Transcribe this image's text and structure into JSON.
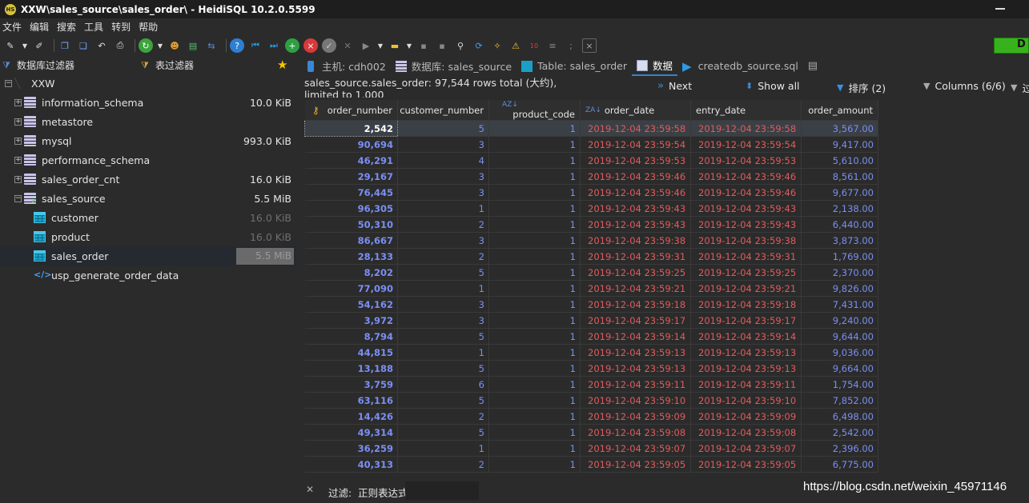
{
  "window": {
    "title": "XXW\\sales_source\\sales_order\\ - HeidiSQL 10.2.0.5599",
    "logo_text": "HS"
  },
  "menu": [
    "文件",
    "编辑",
    "搜索",
    "工具",
    "转到",
    "帮助"
  ],
  "toolbar": {
    "indicator_text": "D"
  },
  "left": {
    "db_filter_label": "数据库过滤器",
    "table_filter_label": "表过滤器",
    "tree": [
      {
        "label": "XXW",
        "size": "",
        "kind": "server"
      },
      {
        "label": "information_schema",
        "size": "10.0 KiB",
        "kind": "db"
      },
      {
        "label": "metastore",
        "size": "",
        "kind": "db"
      },
      {
        "label": "mysql",
        "size": "993.0 KiB",
        "kind": "db"
      },
      {
        "label": "performance_schema",
        "size": "",
        "kind": "db"
      },
      {
        "label": "sales_order_cnt",
        "size": "16.0 KiB",
        "kind": "db"
      },
      {
        "label": "sales_source",
        "size": "5.5 MiB",
        "kind": "db-open"
      },
      {
        "label": "customer",
        "size": "16.0 KiB",
        "kind": "table"
      },
      {
        "label": "product",
        "size": "16.0 KiB",
        "kind": "table"
      },
      {
        "label": "sales_order",
        "size": "5.5 MiB",
        "kind": "table-selected"
      },
      {
        "label": "usp_generate_order_data",
        "size": "",
        "kind": "procedure"
      }
    ]
  },
  "tabs": [
    {
      "label": "主机: cdh002"
    },
    {
      "label": "数据库: sales_source"
    },
    {
      "label": "Table: sales_order"
    },
    {
      "label": "数据"
    },
    {
      "label": "createdb_source.sql"
    }
  ],
  "info": {
    "row_info": "sales_source.sales_order: 97,544 rows total (大约), limited to 1,000",
    "next": "Next",
    "show_all": "Show all",
    "sort": "排序 (2)",
    "columns": "Columns (6/6)",
    "filter_trunc": "过"
  },
  "grid": {
    "columns": [
      "order_number",
      "customer_number",
      "product_code",
      "order_date",
      "entry_date",
      "order_amount"
    ],
    "rows": [
      [
        "2,542",
        "5",
        "1",
        "2019-12-04 23:59:58",
        "2019-12-04 23:59:58",
        "3,567.00"
      ],
      [
        "90,694",
        "3",
        "1",
        "2019-12-04 23:59:54",
        "2019-12-04 23:59:54",
        "9,417.00"
      ],
      [
        "46,291",
        "4",
        "1",
        "2019-12-04 23:59:53",
        "2019-12-04 23:59:53",
        "5,610.00"
      ],
      [
        "29,167",
        "3",
        "1",
        "2019-12-04 23:59:46",
        "2019-12-04 23:59:46",
        "8,561.00"
      ],
      [
        "76,445",
        "3",
        "1",
        "2019-12-04 23:59:46",
        "2019-12-04 23:59:46",
        "9,677.00"
      ],
      [
        "96,305",
        "1",
        "1",
        "2019-12-04 23:59:43",
        "2019-12-04 23:59:43",
        "2,138.00"
      ],
      [
        "50,310",
        "2",
        "1",
        "2019-12-04 23:59:43",
        "2019-12-04 23:59:43",
        "6,440.00"
      ],
      [
        "86,667",
        "3",
        "1",
        "2019-12-04 23:59:38",
        "2019-12-04 23:59:38",
        "3,873.00"
      ],
      [
        "28,133",
        "2",
        "1",
        "2019-12-04 23:59:31",
        "2019-12-04 23:59:31",
        "1,769.00"
      ],
      [
        "8,202",
        "5",
        "1",
        "2019-12-04 23:59:25",
        "2019-12-04 23:59:25",
        "2,370.00"
      ],
      [
        "77,090",
        "1",
        "1",
        "2019-12-04 23:59:21",
        "2019-12-04 23:59:21",
        "9,826.00"
      ],
      [
        "54,162",
        "3",
        "1",
        "2019-12-04 23:59:18",
        "2019-12-04 23:59:18",
        "7,431.00"
      ],
      [
        "3,972",
        "3",
        "1",
        "2019-12-04 23:59:17",
        "2019-12-04 23:59:17",
        "9,240.00"
      ],
      [
        "8,794",
        "5",
        "1",
        "2019-12-04 23:59:14",
        "2019-12-04 23:59:14",
        "9,644.00"
      ],
      [
        "44,815",
        "1",
        "1",
        "2019-12-04 23:59:13",
        "2019-12-04 23:59:13",
        "9,036.00"
      ],
      [
        "13,188",
        "5",
        "1",
        "2019-12-04 23:59:13",
        "2019-12-04 23:59:13",
        "9,664.00"
      ],
      [
        "3,759",
        "6",
        "1",
        "2019-12-04 23:59:11",
        "2019-12-04 23:59:11",
        "1,754.00"
      ],
      [
        "63,116",
        "5",
        "1",
        "2019-12-04 23:59:10",
        "2019-12-04 23:59:10",
        "7,852.00"
      ],
      [
        "14,426",
        "2",
        "1",
        "2019-12-04 23:59:09",
        "2019-12-04 23:59:09",
        "6,498.00"
      ],
      [
        "49,314",
        "5",
        "1",
        "2019-12-04 23:59:08",
        "2019-12-04 23:59:08",
        "2,542.00"
      ],
      [
        "36,259",
        "1",
        "1",
        "2019-12-04 23:59:07",
        "2019-12-04 23:59:07",
        "2,396.00"
      ],
      [
        "40,313",
        "2",
        "1",
        "2019-12-04 23:59:05",
        "2019-12-04 23:59:05",
        "6,775.00"
      ]
    ]
  },
  "footer": {
    "filter_label": "过滤:",
    "regex_label": "正则表达式"
  },
  "watermark": "https://blog.csdn.net/weixin_45971146",
  "colors": {
    "background": "#2b2b2b",
    "number_text": "#7a8ff4",
    "date_text": "#e25b5b",
    "accent": "#3c80c6",
    "indicator": "#38b21c"
  }
}
